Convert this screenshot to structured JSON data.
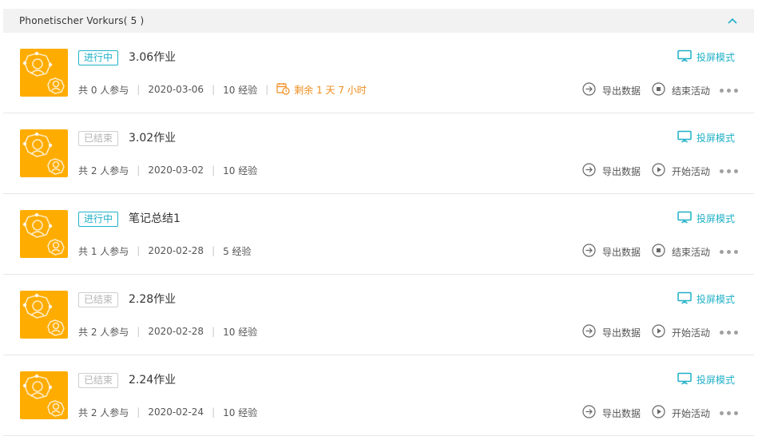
{
  "header": {
    "title": "Phonetischer Vorkurs( 5 )",
    "toggle_icon": "chevron-up-icon"
  },
  "colors": {
    "accent": "#1fb0c7",
    "thumb": "#ffac00",
    "warning": "#f08c1c"
  },
  "labels": {
    "projection": "投屏模式",
    "export": "导出数据",
    "end": "结束活动",
    "start": "开始活动"
  },
  "activities": [
    {
      "status": "进行中",
      "status_type": "active",
      "title": "3.06作业",
      "participants": "共 0 人参与",
      "date": "2020-03-06",
      "experience": "10 经验",
      "remaining": "剩余 1 天 7 小时",
      "action": "结束活动",
      "action_icon": "stop-icon"
    },
    {
      "status": "已结束",
      "status_type": "ended",
      "title": "3.02作业",
      "participants": "共 2 人参与",
      "date": "2020-03-02",
      "experience": "10 经验",
      "action": "开始活动",
      "action_icon": "play-icon"
    },
    {
      "status": "进行中",
      "status_type": "active",
      "title": "笔记总结1",
      "participants": "共 1 人参与",
      "date": "2020-02-28",
      "experience": "5 经验",
      "action": "结束活动",
      "action_icon": "stop-icon"
    },
    {
      "status": "已结束",
      "status_type": "ended",
      "title": "2.28作业",
      "participants": "共 2 人参与",
      "date": "2020-02-28",
      "experience": "10 经验",
      "action": "开始活动",
      "action_icon": "play-icon"
    },
    {
      "status": "已结束",
      "status_type": "ended",
      "title": "2.24作业",
      "participants": "共 2 人参与",
      "date": "2020-02-24",
      "experience": "10 经验",
      "action": "开始活动",
      "action_icon": "play-icon"
    }
  ]
}
